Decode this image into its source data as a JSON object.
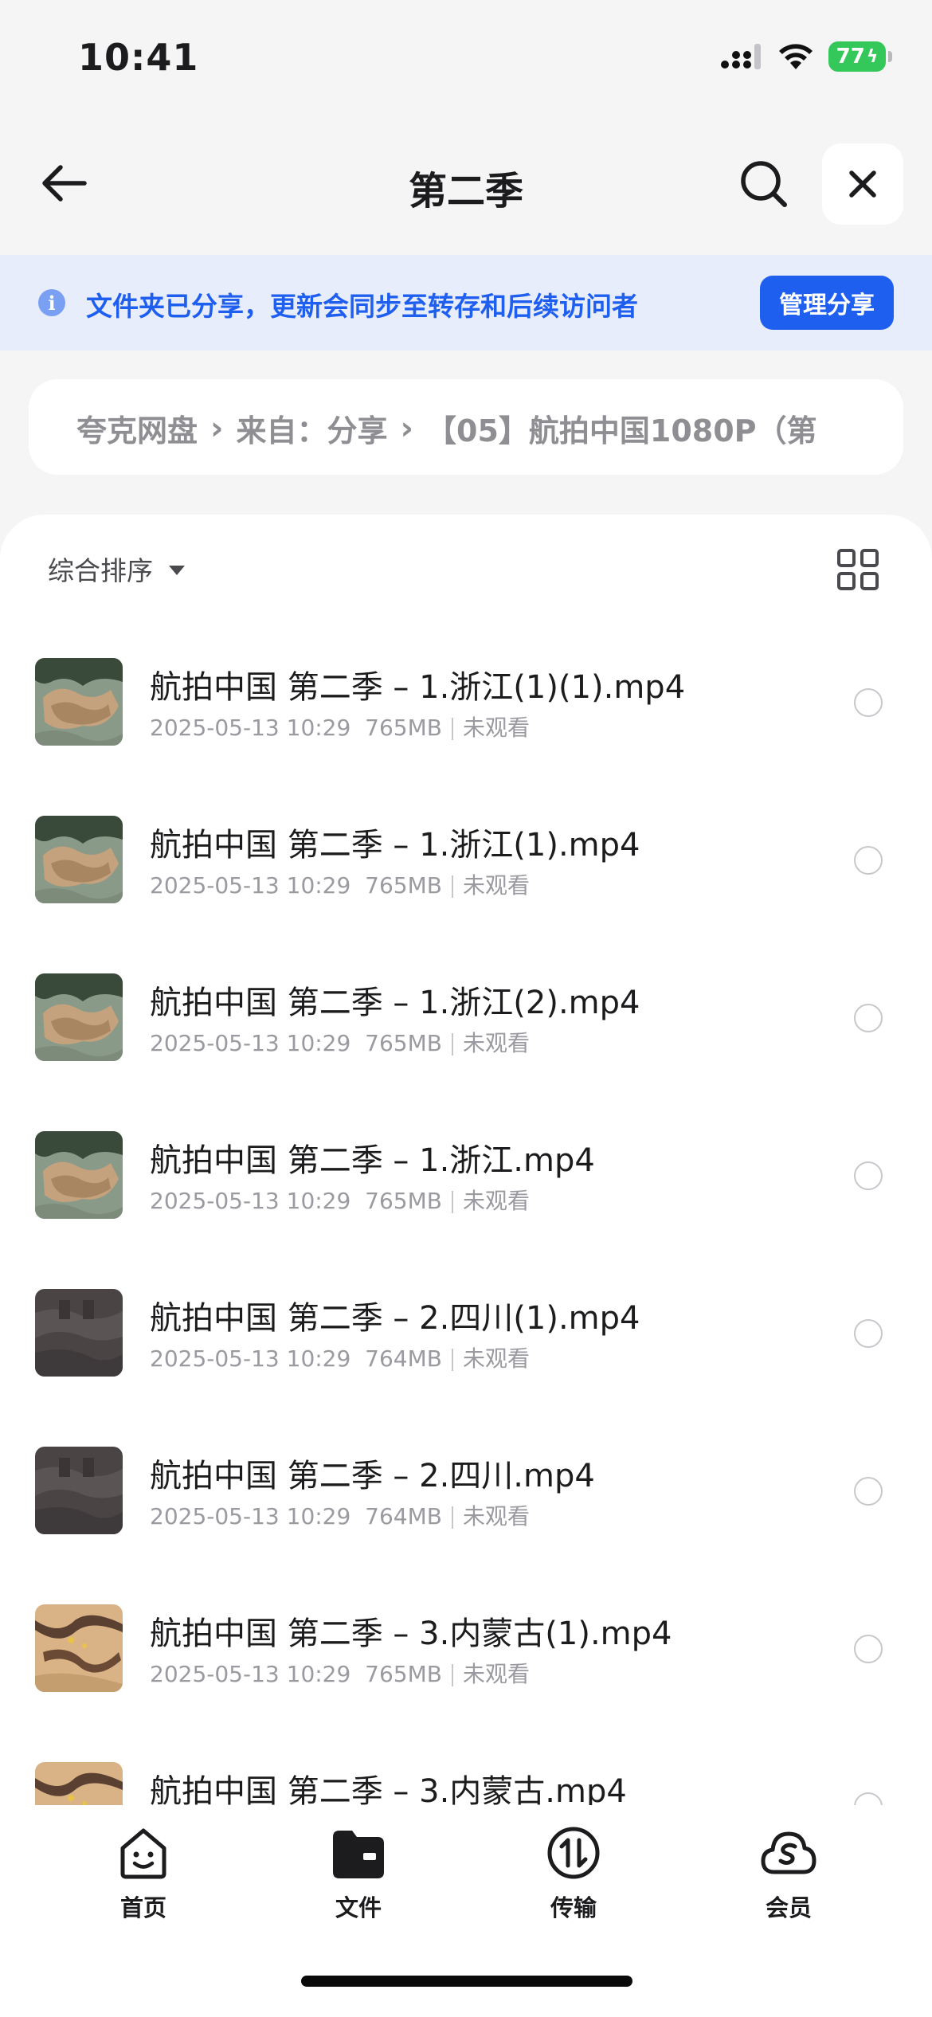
{
  "status": {
    "time": "10:41",
    "battery": "77"
  },
  "nav": {
    "title": "第二季"
  },
  "banner": {
    "text": "文件夹已分享，更新会同步至转存和后续访问者",
    "button": "管理分享",
    "info_glyph": "i"
  },
  "breadcrumb": {
    "items": [
      "夸克网盘",
      "来自：分享",
      "【05】航拍中国1080P（第"
    ]
  },
  "sort": {
    "label": "综合排序"
  },
  "files": [
    {
      "name": "航拍中国 第二季 – 1.浙江(1)(1).mp4",
      "date": "2025-05-13 10:29",
      "size": "765MB",
      "status": "未观看",
      "thumb": "coast"
    },
    {
      "name": "航拍中国 第二季 – 1.浙江(1).mp4",
      "date": "2025-05-13 10:29",
      "size": "765MB",
      "status": "未观看",
      "thumb": "coast"
    },
    {
      "name": "航拍中国 第二季 – 1.浙江(2).mp4",
      "date": "2025-05-13 10:29",
      "size": "765MB",
      "status": "未观看",
      "thumb": "coast"
    },
    {
      "name": "航拍中国 第二季 – 1.浙江.mp4",
      "date": "2025-05-13 10:29",
      "size": "765MB",
      "status": "未观看",
      "thumb": "coast"
    },
    {
      "name": "航拍中国 第二季 – 2.四川(1).mp4",
      "date": "2025-05-13 10:29",
      "size": "764MB",
      "status": "未观看",
      "thumb": "dark"
    },
    {
      "name": "航拍中国 第二季 – 2.四川.mp4",
      "date": "2025-05-13 10:29",
      "size": "764MB",
      "status": "未观看",
      "thumb": "dark"
    },
    {
      "name": "航拍中国 第二季 – 3.内蒙古(1).mp4",
      "date": "2025-05-13 10:29",
      "size": "765MB",
      "status": "未观看",
      "thumb": "desert"
    },
    {
      "name": "航拍中国 第二季 – 3.内蒙古.mp4",
      "date": "",
      "size": "",
      "status": "",
      "thumb": "desert"
    }
  ],
  "tabs": [
    {
      "label": "首页",
      "icon": "home-face-icon"
    },
    {
      "label": "文件",
      "icon": "folder-icon"
    },
    {
      "label": "传输",
      "icon": "transfer-icon"
    },
    {
      "label": "会员",
      "icon": "cloud-member-icon"
    }
  ],
  "colors": {
    "accent": "#1f5ff0",
    "banner_bg": "#e8edfb",
    "battery": "#34c759"
  }
}
